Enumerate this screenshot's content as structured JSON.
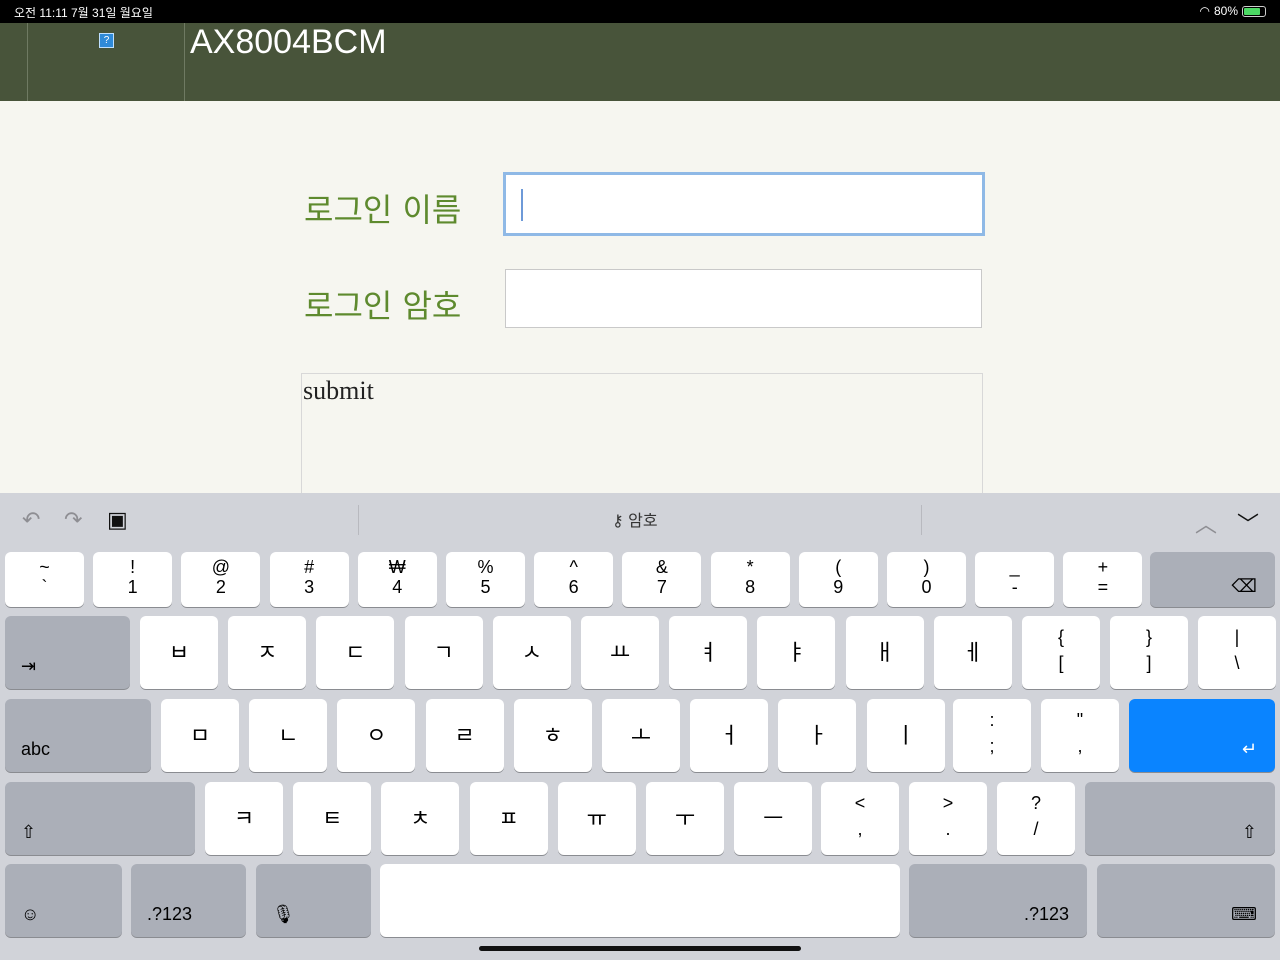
{
  "status": {
    "time": "오전 11:11   7월 31일 월요일",
    "battery": "80%"
  },
  "header": {
    "title": "AX8004BCM",
    "help_icon": "?"
  },
  "form": {
    "username_label": "로그인 이름",
    "username_value": "",
    "password_label": "로그인 암호",
    "password_value": "",
    "submit_label": "submit"
  },
  "toolbar": {
    "undo": "↶",
    "redo": "↷",
    "clipboard": "▣",
    "password_hint": "암호",
    "up": "︿",
    "down": "﹀"
  },
  "keyboard": {
    "row1": [
      [
        "~",
        "`"
      ],
      [
        "!",
        "1"
      ],
      [
        "@",
        "2"
      ],
      [
        "#",
        "3"
      ],
      [
        "₩",
        "4"
      ],
      [
        "%",
        "5"
      ],
      [
        "^",
        "6"
      ],
      [
        "&",
        "7"
      ],
      [
        "*",
        "8"
      ],
      [
        "(",
        "9"
      ],
      [
        ")",
        "0"
      ],
      [
        "_",
        "-"
      ],
      [
        "+",
        "="
      ]
    ],
    "row2": [
      "ㅂ",
      "ㅈ",
      "ㄷ",
      "ㄱ",
      "ㅅ",
      "ㅛ",
      "ㅕ",
      "ㅑ",
      "ㅐ",
      "ㅔ"
    ],
    "row2_sym": [
      [
        "{",
        "["
      ],
      [
        "}",
        "]"
      ],
      [
        "|",
        "\\"
      ]
    ],
    "row3": [
      "ㅁ",
      "ㄴ",
      "ㅇ",
      "ㄹ",
      "ㅎ",
      "ㅗ",
      "ㅓ",
      "ㅏ",
      "ㅣ"
    ],
    "row3_sym": [
      [
        ":",
        ";"
      ],
      [
        "\"",
        ","
      ]
    ],
    "row4": [
      "ㅋ",
      "ㅌ",
      "ㅊ",
      "ㅍ",
      "ㅠ",
      "ㅜ",
      "ㅡ"
    ],
    "row4_sym": [
      [
        "<",
        ","
      ],
      [
        ">",
        "."
      ],
      [
        "?",
        "/"
      ]
    ],
    "tab_label": "⇥",
    "abc_label": "abc",
    "shift_label": "⇧",
    "backspace_label": "⌫",
    "return_label": "↵",
    "emoji_label": "☺",
    "num_label": ".?123",
    "mic_label": "🎙",
    "hide_label": "⌨"
  }
}
